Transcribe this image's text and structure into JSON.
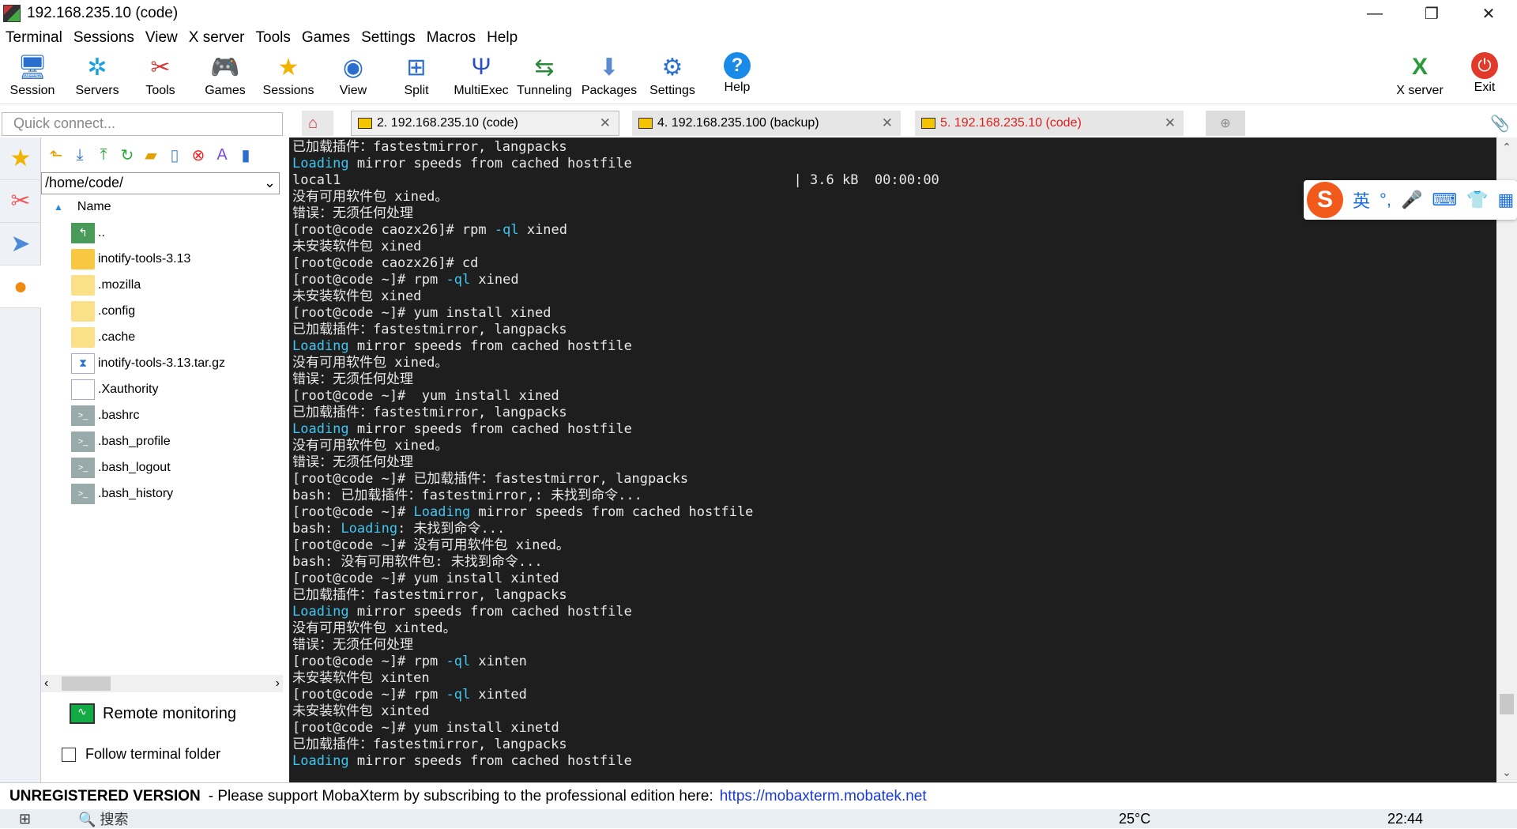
{
  "window": {
    "title": "192.168.235.10 (code)",
    "controls": [
      "—",
      "❐",
      "✕"
    ]
  },
  "menu": [
    "Terminal",
    "Sessions",
    "View",
    "X server",
    "Tools",
    "Games",
    "Settings",
    "Macros",
    "Help"
  ],
  "toolbar": [
    {
      "label": "Session",
      "icon": "monitor-icon"
    },
    {
      "label": "Servers",
      "icon": "servers-icon"
    },
    {
      "label": "Tools",
      "icon": "tools-icon"
    },
    {
      "label": "Games",
      "icon": "gamepad-icon"
    },
    {
      "label": "Sessions",
      "icon": "star-icon"
    },
    {
      "label": "View",
      "icon": "view-icon"
    },
    {
      "label": "Split",
      "icon": "split-icon"
    },
    {
      "label": "MultiExec",
      "icon": "fork-icon"
    },
    {
      "label": "Tunneling",
      "icon": "tunnel-icon"
    },
    {
      "label": "Packages",
      "icon": "package-icon"
    },
    {
      "label": "Settings",
      "icon": "gear-icon"
    },
    {
      "label": "Help",
      "icon": "help-icon"
    }
  ],
  "toolbar_right": [
    {
      "label": "X server",
      "icon": "x-server-icon"
    },
    {
      "label": "Exit",
      "icon": "power-icon"
    }
  ],
  "quick_connect": {
    "placeholder": "Quick connect..."
  },
  "tabs": [
    {
      "label": "2. 192.168.235.10 (code)",
      "active": true
    },
    {
      "label": "4. 192.168.235.100 (backup)",
      "active": false
    },
    {
      "label": "5. 192.168.235.10 (code)",
      "active": false,
      "color": "#e0201c"
    }
  ],
  "file_panel": {
    "path": "/home/code/",
    "column_header": "Name",
    "files": [
      {
        "name": "..",
        "type": "up"
      },
      {
        "name": "inotify-tools-3.13",
        "type": "folder"
      },
      {
        "name": ".mozilla",
        "type": "folder-light"
      },
      {
        "name": ".config",
        "type": "folder-light"
      },
      {
        "name": ".cache",
        "type": "folder-light"
      },
      {
        "name": "inotify-tools-3.13.tar.gz",
        "type": "archive"
      },
      {
        "name": ".Xauthority",
        "type": "doc"
      },
      {
        "name": ".bashrc",
        "type": "shell"
      },
      {
        "name": ".bash_profile",
        "type": "shell"
      },
      {
        "name": ".bash_logout",
        "type": "shell"
      },
      {
        "name": ".bash_history",
        "type": "shell"
      }
    ],
    "remote_monitoring": "Remote monitoring",
    "follow_folder": "Follow terminal folder"
  },
  "terminal_lines": [
    [
      {
        "t": "已加载插件：fastestmirror, langpacks"
      }
    ],
    [
      {
        "t": "Loading",
        "hl": true
      },
      {
        "t": " mirror speeds from cached hostfile"
      }
    ],
    [
      {
        "t": "local1                                                        | 3.6 kB  00:00:00"
      }
    ],
    [
      {
        "t": "没有可用软件包 xined。"
      }
    ],
    [
      {
        "t": "错误：无须任何处理"
      }
    ],
    [
      {
        "t": "[root@code caozx26]# rpm "
      },
      {
        "t": "-ql",
        "hl": true
      },
      {
        "t": " xined"
      }
    ],
    [
      {
        "t": "未安装软件包 xined"
      }
    ],
    [
      {
        "t": "[root@code caozx26]# cd"
      }
    ],
    [
      {
        "t": "[root@code ~]# rpm "
      },
      {
        "t": "-ql",
        "hl": true
      },
      {
        "t": " xined"
      }
    ],
    [
      {
        "t": "未安装软件包 xined"
      }
    ],
    [
      {
        "t": "[root@code ~]# yum install xined"
      }
    ],
    [
      {
        "t": "已加载插件：fastestmirror, langpacks"
      }
    ],
    [
      {
        "t": "Loading",
        "hl": true
      },
      {
        "t": " mirror speeds from cached hostfile"
      }
    ],
    [
      {
        "t": "没有可用软件包 xined。"
      }
    ],
    [
      {
        "t": "错误：无须任何处理"
      }
    ],
    [
      {
        "t": "[root@code ~]#  yum install xined"
      }
    ],
    [
      {
        "t": "已加载插件：fastestmirror, langpacks"
      }
    ],
    [
      {
        "t": "Loading",
        "hl": true
      },
      {
        "t": " mirror speeds from cached hostfile"
      }
    ],
    [
      {
        "t": "没有可用软件包 xined。"
      }
    ],
    [
      {
        "t": "错误：无须任何处理"
      }
    ],
    [
      {
        "t": "[root@code ~]# 已加载插件：fastestmirror, langpacks"
      }
    ],
    [
      {
        "t": "bash: 已加载插件：fastestmirror,: 未找到命令..."
      }
    ],
    [
      {
        "t": "[root@code ~]# "
      },
      {
        "t": "Loading",
        "hl": true
      },
      {
        "t": " mirror speeds from cached hostfile"
      }
    ],
    [
      {
        "t": "bash: "
      },
      {
        "t": "Loading",
        "hl": true
      },
      {
        "t": ": 未找到命令..."
      }
    ],
    [
      {
        "t": "[root@code ~]# 没有可用软件包 xined。"
      }
    ],
    [
      {
        "t": "bash: 没有可用软件包: 未找到命令..."
      }
    ],
    [
      {
        "t": "[root@code ~]# yum install xinted"
      }
    ],
    [
      {
        "t": "已加载插件：fastestmirror, langpacks"
      }
    ],
    [
      {
        "t": "Loading",
        "hl": true
      },
      {
        "t": " mirror speeds from cached hostfile"
      }
    ],
    [
      {
        "t": "没有可用软件包 xinted。"
      }
    ],
    [
      {
        "t": "错误：无须任何处理"
      }
    ],
    [
      {
        "t": "[root@code ~]# rpm "
      },
      {
        "t": "-ql",
        "hl": true
      },
      {
        "t": " xinten"
      }
    ],
    [
      {
        "t": "未安装软件包 xinten"
      }
    ],
    [
      {
        "t": "[root@code ~]# rpm "
      },
      {
        "t": "-ql",
        "hl": true
      },
      {
        "t": " xinted"
      }
    ],
    [
      {
        "t": "未安装软件包 xinted"
      }
    ],
    [
      {
        "t": "[root@code ~]# yum install xinetd"
      }
    ],
    [
      {
        "t": "已加载插件：fastestmirror, langpacks"
      }
    ],
    [
      {
        "t": "Loading",
        "hl": true
      },
      {
        "t": " mirror speeds from cached hostfile"
      }
    ]
  ],
  "ime": {
    "lang": "英",
    "items": [
      "°,",
      "🎤",
      "⌨",
      "👕",
      "▦"
    ]
  },
  "status": {
    "unregistered": "UNREGISTERED VERSION",
    "message": "-  Please support MobaXterm by subscribing to the professional edition here:",
    "link": "https://mobaxterm.mobatek.net"
  },
  "taskbar": {
    "search": "搜索",
    "temp": "25°C",
    "time": "22:44"
  }
}
